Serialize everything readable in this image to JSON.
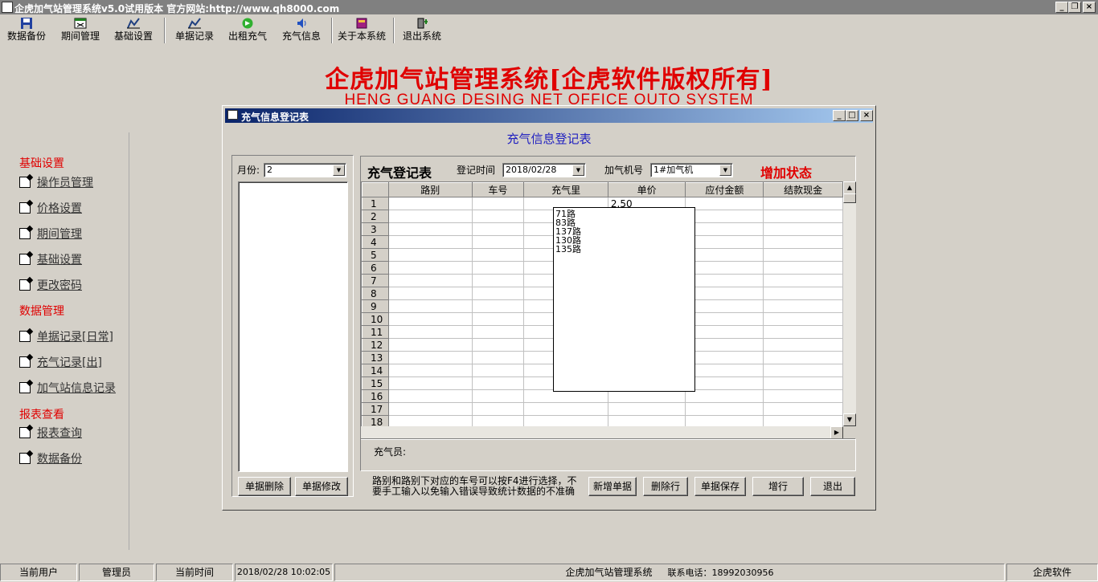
{
  "window": {
    "title": "企虎加气站管理系统v5.0试用版本 官方网站:http://www.qh8000.com"
  },
  "toolbar": {
    "items": [
      {
        "label": "数据备份",
        "icon": "disk-icon"
      },
      {
        "label": "期间管理",
        "icon": "calendar-icon"
      },
      {
        "label": "基础设置",
        "icon": "settings-icon"
      },
      {
        "label": "单据记录",
        "icon": "record-icon"
      },
      {
        "label": "出租充气",
        "icon": "go-icon"
      },
      {
        "label": "充气信息",
        "icon": "speaker-icon"
      },
      {
        "label": "关于本系统",
        "icon": "book-icon"
      },
      {
        "label": "退出系统",
        "icon": "exit-icon"
      }
    ]
  },
  "banner": {
    "title": "企虎加气站管理系统[企虎软件版权所有]",
    "subtitle": "HENG GUANG DESING NET OFFICE OUTO SYSTEM"
  },
  "sidebar": {
    "sec1": "基础设置",
    "basic": [
      "操作员管理",
      "价格设置",
      "期间管理",
      "基础设置",
      "更改密码"
    ],
    "sec2": "数据管理",
    "data": [
      "单据记录[日常]",
      "充气记录[出]",
      "加气站信息记录"
    ],
    "sec3": "报表查看",
    "report": [
      "报表查询",
      "数据备份"
    ]
  },
  "dialog": {
    "title": "充气信息登记表",
    "heading": "充气信息登记表",
    "month_label": "月份:",
    "month_value": "2",
    "delete_bill": "单据删除",
    "modify_bill": "单据修改",
    "form_title": "充气登记表",
    "date_label": "登记时间",
    "date_value": "2018/02/28",
    "machine_label": "加气机号",
    "machine_value": "1#加气机",
    "state": "增加状态",
    "columns": [
      "路别",
      "车号",
      "充气里",
      "单价",
      "应付金额",
      "结款现金"
    ],
    "first_price": "2.50",
    "dropdown": [
      "71路",
      "83路",
      "137路",
      "130路",
      "135路"
    ],
    "operator_label": "充气员:",
    "hint": "路别和路别下对应的车号可以按F4进行选择，不要手工输入以免输入错误导致统计数据的不准确",
    "buttons": {
      "new": "新增单据",
      "delrow": "删除行",
      "save": "单据保存",
      "addrow": "增行",
      "exit": "退出"
    }
  },
  "status": {
    "user_label": "当前用户",
    "user_value": "管理员",
    "time_label": "当前时间",
    "time_value": "2018/02/28 10:02:05",
    "system": "企虎加气站管理系统",
    "phone": "联系电话：18992030956",
    "brand": "企虎软件"
  }
}
